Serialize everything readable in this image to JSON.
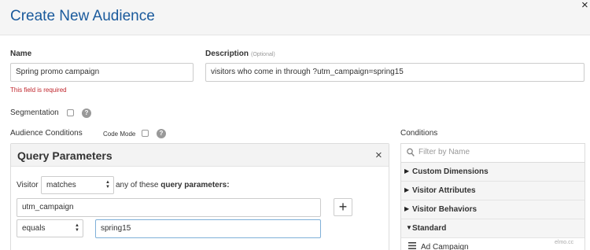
{
  "dialog": {
    "title": "Create New Audience",
    "close": "×"
  },
  "form": {
    "name_label": "Name",
    "name_value": "Spring promo campaign",
    "name_error": "This field is required",
    "description_label": "Description",
    "description_optional": "(Optional)",
    "description_value": "visitors who come in through ?utm_campaign=spring15",
    "segmentation_label": "Segmentation",
    "audience_conditions_label": "Audience Conditions",
    "code_mode_label": "Code Mode",
    "help_glyph": "?"
  },
  "query_parameters": {
    "title": "Query Parameters",
    "close": "×",
    "visitor_label": "Visitor",
    "match_select": "matches",
    "any_of_these": "any of these",
    "query_parameters_text": "query parameters:",
    "param_name": "utm_campaign",
    "add_button": "+",
    "operator_select": "equals",
    "param_value": "spring15"
  },
  "conditions": {
    "label": "Conditions",
    "filter_placeholder": "Filter by Name",
    "categories": [
      {
        "label": "Custom Dimensions",
        "arrow": "▶"
      },
      {
        "label": "Visitor Attributes",
        "arrow": "▶"
      },
      {
        "label": "Visitor Behaviors",
        "arrow": "▶"
      },
      {
        "label": "Standard",
        "arrow": "▼"
      }
    ],
    "standard_items": [
      {
        "label": "Ad Campaign",
        "icon": "list-icon"
      }
    ]
  },
  "watermark": "elmo.cc"
}
